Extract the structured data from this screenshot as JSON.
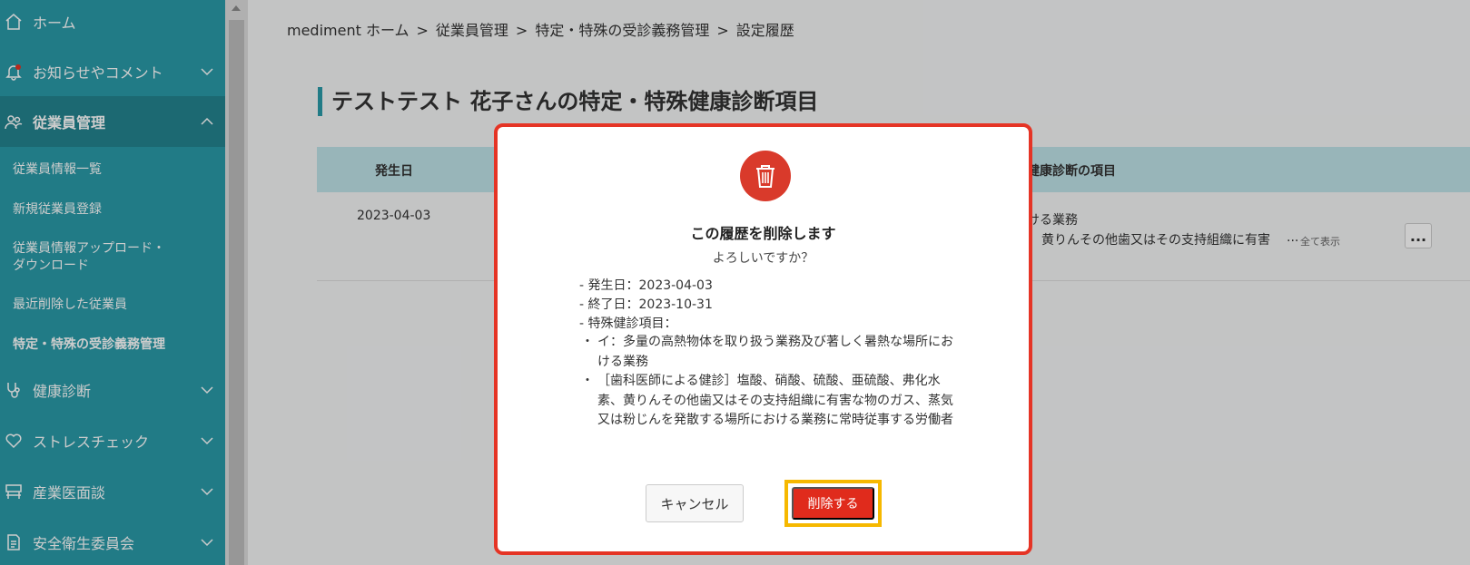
{
  "sidebar": {
    "home": "ホーム",
    "notices": "お知らせやコメント",
    "employee_mgmt": "従業員管理",
    "sub_items": [
      "従業員情報一覧",
      "新規従業員登録",
      "従業員情報アップロード・\nダウンロード",
      "最近削除した従業員",
      "特定・特殊の受診義務管理"
    ],
    "health_check": "健康診断",
    "stress_check": "ストレスチェック",
    "occupational_doctor": "産業医面談",
    "safety_committee": "安全衛生委員会"
  },
  "breadcrumb": {
    "items": [
      "mediment ホーム",
      "従業員管理",
      "特定・特殊の受診義務管理",
      "設定履歴"
    ],
    "separator": ">"
  },
  "page": {
    "title": "テストテスト 花子さんの特定・特殊健康診断項目"
  },
  "table": {
    "headers": [
      "発生日",
      "健康診断の項目"
    ],
    "rows": [
      {
        "date": "2023-04-03",
        "item_line1": "ける業務",
        "item_line2": "黄りんその他歯又はその支持組織に有害",
        "ellipsis": "...",
        "show_all": "全て表示",
        "more": "..."
      }
    ]
  },
  "dialog": {
    "title": "この履歴を削除します",
    "subtitle": "よろしいですか？",
    "details": [
      "-  発生日：2023-04-03",
      "-  終了日：2023-10-31",
      "-  特殊健診項目："
    ],
    "items": [
      "イ：多量の高熱物体を取り扱う業務及び著しく暑熱な場所における業務",
      "［歯科医師による健診］塩酸、硝酸、硫酸、亜硫酸、弗化水素、黄りんその他歯又はその支持組織に有害な物のガス、蒸気又は粉じんを発散する場所における業務に常時従事する労働者"
    ],
    "bullet": "・",
    "cancel_label": "キャンセル",
    "delete_label": "削除する"
  },
  "colors": {
    "sidebar": "#2a9aa8",
    "sidebar_active": "#23848f",
    "table_header": "#bfe3e8",
    "danger": "#e02b1c",
    "highlight": "#f6b800"
  }
}
